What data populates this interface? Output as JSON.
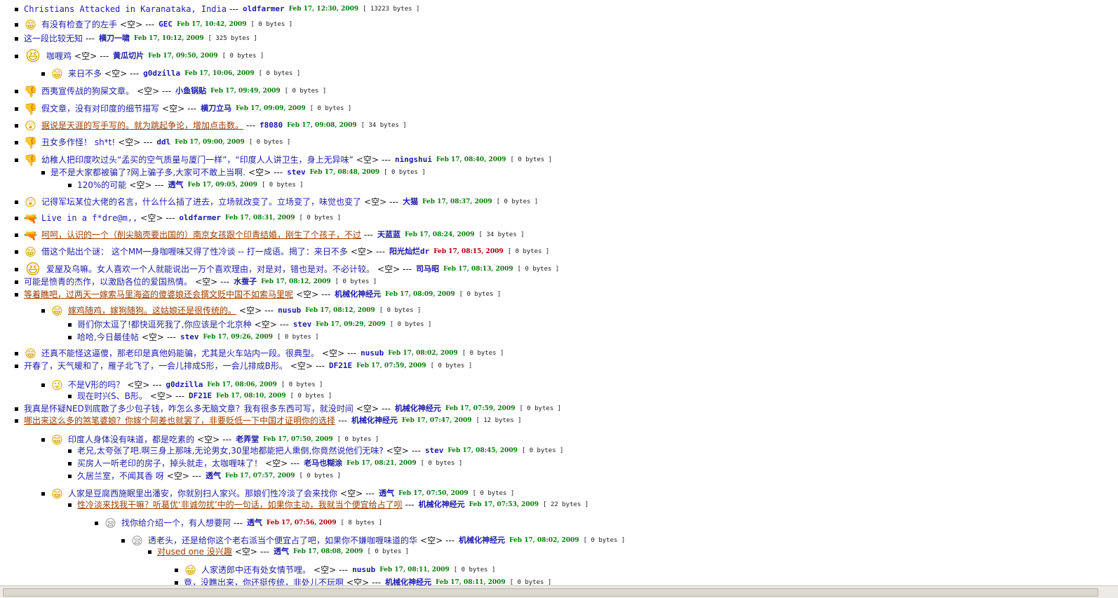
{
  "empty_marker": "<空>",
  "separator": "---",
  "posts": [
    {
      "icon": "none",
      "title": "Christians Attacked in Karanataka, India",
      "author": "oldfarmer",
      "time": "Feb 17, 12:30, 2009",
      "size": "[ 13223 bytes ]",
      "empty": false
    },
    {
      "icon": "grin",
      "title": "有没有检查了的左手",
      "author": "GEC",
      "time": "Feb 17, 10:42, 2009",
      "size": "[ 0 bytes ]",
      "empty": true
    },
    {
      "icon": "none",
      "title": "这一段比较无知",
      "author": "横刀一啸",
      "time": "Feb 17, 10:12, 2009",
      "size": "[ 325 bytes ]",
      "empty": false
    },
    {
      "icon": "grin-big",
      "title": "咖喱鸡",
      "author": "黄瓜切片",
      "time": "Feb 17, 09:50, 2009",
      "size": "[ 0 bytes ]",
      "empty": true
    },
    {
      "icon": "grin",
      "title": "来日不多",
      "author": "g0dzilla",
      "time": "Feb 17, 10:06, 2009",
      "size": "[ 0 bytes ]",
      "empty": true
    },
    {
      "icon": "thumb-down",
      "title": "西夷宣传战的狗屎文章。",
      "author": "小鱼锅贴",
      "time": "Feb 17, 09:49, 2009",
      "size": "[ 0 bytes ]",
      "empty": true
    },
    {
      "icon": "thumb-down",
      "title": "假文章，没有对印度的细节描写",
      "author": "横刀立马",
      "time": "Feb 17, 09:09, 2009",
      "size": "[ 0 bytes ]",
      "empty": true
    },
    {
      "icon": "surprised",
      "title": "据说是天涯的写手写的。就为跳起争论，增加点击数。",
      "author": "f8080",
      "time": "Feb 17, 09:08, 2009",
      "size": "[ 34 bytes ]",
      "empty": false
    },
    {
      "icon": "thumb-down",
      "title": "丑女多作怪！ sh*t!",
      "author": "ddl",
      "time": "Feb 17, 09:00, 2009",
      "size": "[ 0 bytes ]",
      "empty": true
    },
    {
      "icon": "thumb-down",
      "title": "幼稚人把印度吹过头“孟买的空气质量与厦门一样”，“印度人人讲卫生，身上无异味”",
      "author": "ningshui",
      "time": "Feb 17, 08:40, 2009",
      "size": "[ 0 bytes ]",
      "empty": true
    },
    {
      "icon": "none",
      "title": "是不是大家都被骗了?网上骗子多,大家可不敢上当啊.",
      "author": "stev",
      "time": "Feb 17, 08:48, 2009",
      "size": "[ 0 bytes ]",
      "empty": true
    },
    {
      "icon": "none",
      "title": "120%的可能",
      "author": "透气",
      "time": "Feb 17, 09:05, 2009",
      "size": "[ 0 bytes ]",
      "empty": true
    },
    {
      "icon": "surprised",
      "title": "记得军坛某位大佬的名言，什么什么插了进去，立场就改变了。立场变了，味觉也变了",
      "author": "大猫",
      "time": "Feb 17, 08:37, 2009",
      "size": "[ 0 bytes ]",
      "empty": true
    },
    {
      "icon": "gun",
      "title": "Live in a f*dre@m,,",
      "author": "oldfarmer",
      "time": "Feb 17, 08:31, 2009",
      "size": "[ 0 bytes ]",
      "empty": true
    },
    {
      "icon": "gun",
      "title": "呵呵，认识的一个（削尖脑壳要出国的）南京女孩跟个印青结婚，刚生了个孩子，不过",
      "author": "天蓝蓝",
      "time": "Feb 17, 08:24, 2009",
      "size": "[ 34 bytes ]",
      "empty": false
    },
    {
      "icon": "grin",
      "title": "借这个贴出个谜：  这个MM一身咖喱味又得了性冷谈 -- 打一成语。揭了：来日不多",
      "author": "阳光灿烂dr",
      "time": "Feb 17, 08:15, 2009",
      "size": "[ 0 bytes ]",
      "empty": true
    },
    {
      "icon": "grin-big",
      "title": "爱屋及乌嘛。女人喜欢一个人就能说出一万个喜欢理由，对是对，错也是对。不必计较。",
      "author": "司马昭",
      "time": "Feb 17, 08:13, 2009",
      "size": "[ 0 bytes ]",
      "empty": true
    },
    {
      "icon": "none",
      "title": "可能是愤青的杰作，以激励各位的爱国热情。",
      "author": "水蚕子",
      "time": "Feb 17, 08:12, 2009",
      "size": "[ 0 bytes ]",
      "empty": true
    },
    {
      "icon": "none",
      "title": "等着瞧吧，过两天一嫁索马里海盗的傻婆娘还会撰文贬中国不如索马里呢",
      "author": "机械化神经元",
      "time": "Feb 17, 08:09, 2009",
      "size": "[ 0 bytes ]",
      "empty": true
    },
    {
      "icon": "grin",
      "title": "嫁鸡随鸡，嫁狗随狗。这姑娘还是很传统的。",
      "author": "nusub",
      "time": "Feb 17, 08:12, 2009",
      "size": "[ 0 bytes ]",
      "empty": true
    },
    {
      "icon": "none",
      "title": "哥们你太逗了!都快逗死我了,你应该是个北京种",
      "author": "stev",
      "time": "Feb 17, 09:29, 2009",
      "size": "[ 0 bytes ]",
      "empty": true
    },
    {
      "icon": "none",
      "title": "哈哈,今日最佳帖",
      "author": "stev",
      "time": "Feb 17, 09:26, 2009",
      "size": "[ 0 bytes ]",
      "empty": true
    },
    {
      "icon": "grin",
      "title": "还真不能怪这逼傻，那老印是真他妈能骗，尤其是火车站内一段。很典型。",
      "author": "nusub",
      "time": "Feb 17, 08:02, 2009",
      "size": "[ 0 bytes ]",
      "empty": true
    },
    {
      "icon": "none",
      "title": "开春了，天气暖和了，雁子北飞了，一会儿排成S形，一会儿排成B形。",
      "author": "DF21E",
      "time": "Feb 17, 07:59, 2009",
      "size": "[ 0 bytes ]",
      "empty": true
    },
    {
      "icon": "wink",
      "title": "不是V形的吗？",
      "author": "g0dzilla",
      "time": "Feb 17, 08:06, 2009",
      "size": "[ 0 bytes ]",
      "empty": true
    },
    {
      "icon": "none",
      "title": "现在时兴S、B形。",
      "author": "DF21E",
      "time": "Feb 17, 08:10, 2009",
      "size": "[ 0 bytes ]",
      "empty": true
    },
    {
      "icon": "none",
      "title": "我真是怀疑NED到底散了多少包子钱，咋怎么多无脑文章？我有很多东西可写，就没时间",
      "author": "机械化神经元",
      "time": "Feb 17, 07:59, 2009",
      "size": "[ 0 bytes ]",
      "empty": true
    },
    {
      "icon": "none",
      "title": "哪出来这么多的煞笔婆娘？你嫁个阿差也就罢了，非要贬低一下中国才证明你的选择",
      "author": "机械化神经元",
      "time": "Feb 17, 07:47, 2009",
      "size": "[ 12 bytes ]",
      "empty": false
    },
    {
      "icon": "grin",
      "title": "印度人身体没有味道，都是吃素的",
      "author": "老弄堂",
      "time": "Feb 17, 07:50, 2009",
      "size": "[ 0 bytes ]",
      "empty": true
    },
    {
      "icon": "none",
      "title": "老兄,太夸张了吧.啊三身上那味,无论男女,30里地都能把人熏倒,你竟然说他们无味?",
      "author": "stev",
      "time": "Feb 17, 08:45, 2009",
      "size": "[ 0 bytes ]",
      "empty": true
    },
    {
      "icon": "none",
      "title": "买房人一听老印的房子，掉头就走，太咖喱味了！",
      "author": "老马也糊涂",
      "time": "Feb 17, 08:21, 2009",
      "size": "[ 0 bytes ]",
      "empty": true
    },
    {
      "icon": "none",
      "title": "久居兰室，不闻其香 呀",
      "author": "透气",
      "time": "Feb 17, 07:57, 2009",
      "size": "[ 0 bytes ]",
      "empty": true
    },
    {
      "icon": "grin",
      "title": "人家是豆腐西施眠里出潘安，你就别扫人家兴。那娘们性冷淡了会来找你",
      "author": "透气",
      "time": "Feb 17, 07:50, 2009",
      "size": "[ 0 bytes ]",
      "empty": true
    },
    {
      "icon": "none",
      "title": "性冷淡来找我干嘛？听葛优‘非诚勿扰’中的一句话，如果你主动，我就当个便宜给占了呗",
      "author": "机械化神经元",
      "time": "Feb 17, 07:53, 2009",
      "size": "[ 22 bytes ]",
      "empty": false
    },
    {
      "icon": "sleepy",
      "title": "找你给介绍一个，有人想要阿",
      "author": "透气",
      "time": "Feb 17, 07:56, 2009",
      "size": "[ 8 bytes ]",
      "empty": false
    },
    {
      "icon": "sleepy",
      "title": "透老头，还是给你这个老右派当个便宜占了吧，如果你不嫌咖喱味道的华",
      "author": "机械化神经元",
      "time": "Feb 17, 08:02, 2009",
      "size": "[ 0 bytes ]",
      "empty": true
    },
    {
      "icon": "none",
      "title": "对used one 没兴趣",
      "author": "透气",
      "time": "Feb 17, 08:08, 2009",
      "size": "[ 0 bytes ]",
      "empty": true
    },
    {
      "icon": "grin",
      "title": "人家透郎中还有处女情节哩。",
      "author": "nusub",
      "time": "Feb 17, 08:11, 2009",
      "size": "[ 0 bytes ]",
      "empty": true
    },
    {
      "icon": "none",
      "title": "竟，没瞧出来，你还挺传统，非处儿不玩啊",
      "author": "机械化神经元",
      "time": "Feb 17, 08:11, 2009",
      "size": "[ 0 bytes ]",
      "empty": true
    }
  ]
}
